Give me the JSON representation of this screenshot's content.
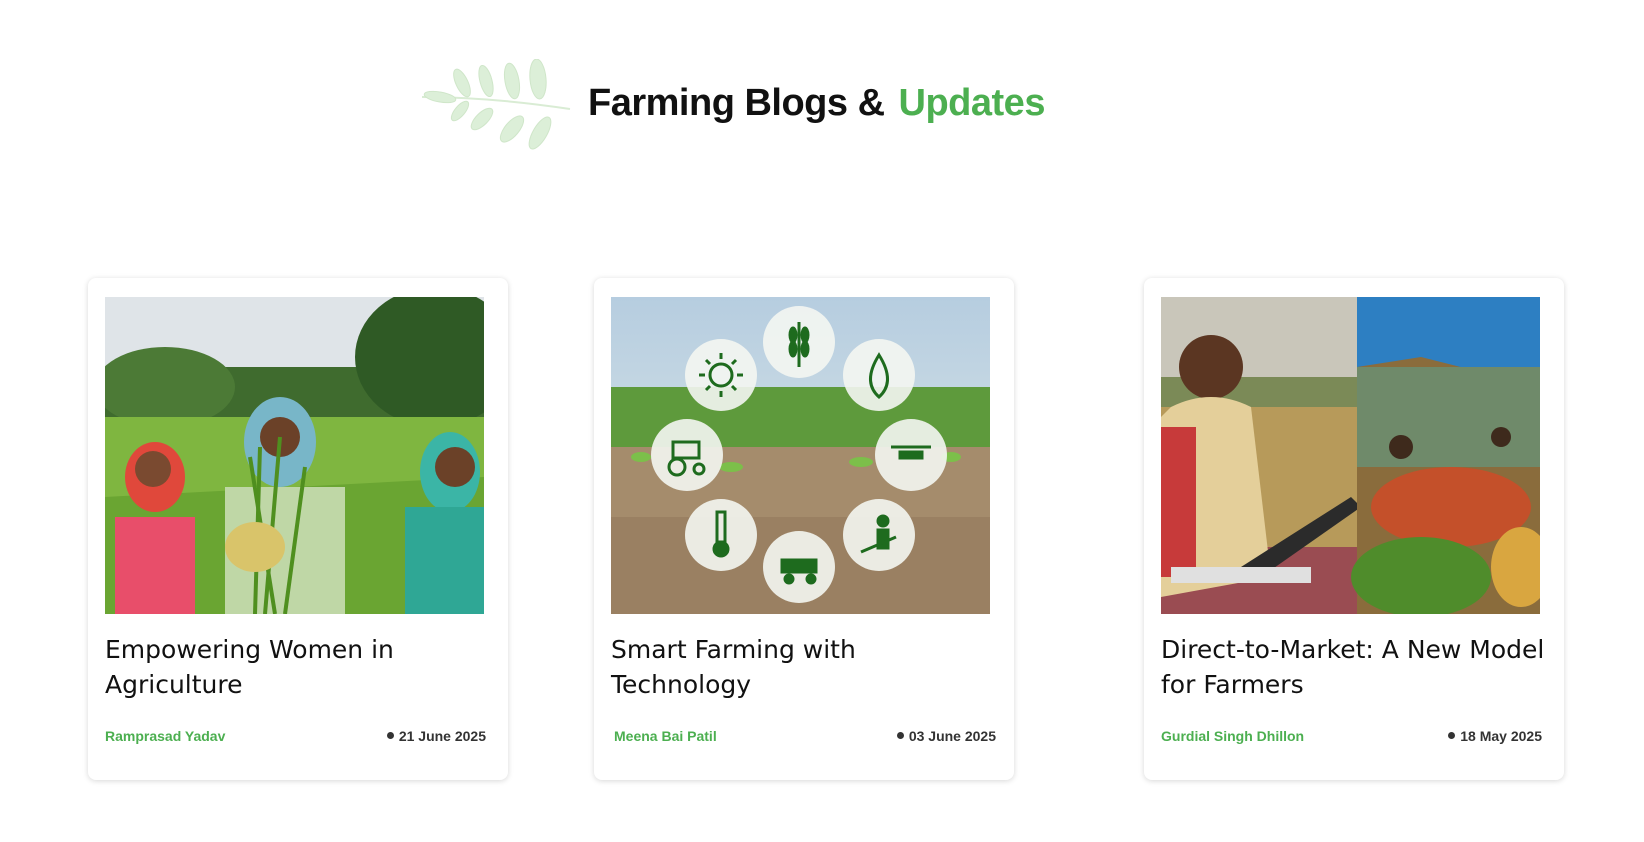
{
  "section": {
    "title_part1": "Farming Blogs &",
    "title_part2": "Updates",
    "accent_color": "#4caf50",
    "decoration_icon": "leaf-branch-icon"
  },
  "posts": [
    {
      "title": "Empowering Women in Agriculture",
      "author": "Ramprasad Yadav",
      "date": "21 June 2025",
      "image": "women-in-rice-field-image"
    },
    {
      "title": "Smart Farming with Technology",
      "author": "Meena Bai Patil",
      "date": "03 June 2025",
      "image": "smart-farming-icons-image",
      "image_icons": [
        "wheat-icon",
        "water-drop-icon",
        "drone-icon",
        "farmer-icon",
        "harvester-icon",
        "thermometer-icon",
        "tractor-icon",
        "sun-icon"
      ]
    },
    {
      "title": "Direct-to-Market: A New Model for Farmers",
      "author": "Gurdial Singh Dhillon",
      "date": "18 May 2025",
      "image": "farmer-laptop-market-image"
    }
  ]
}
